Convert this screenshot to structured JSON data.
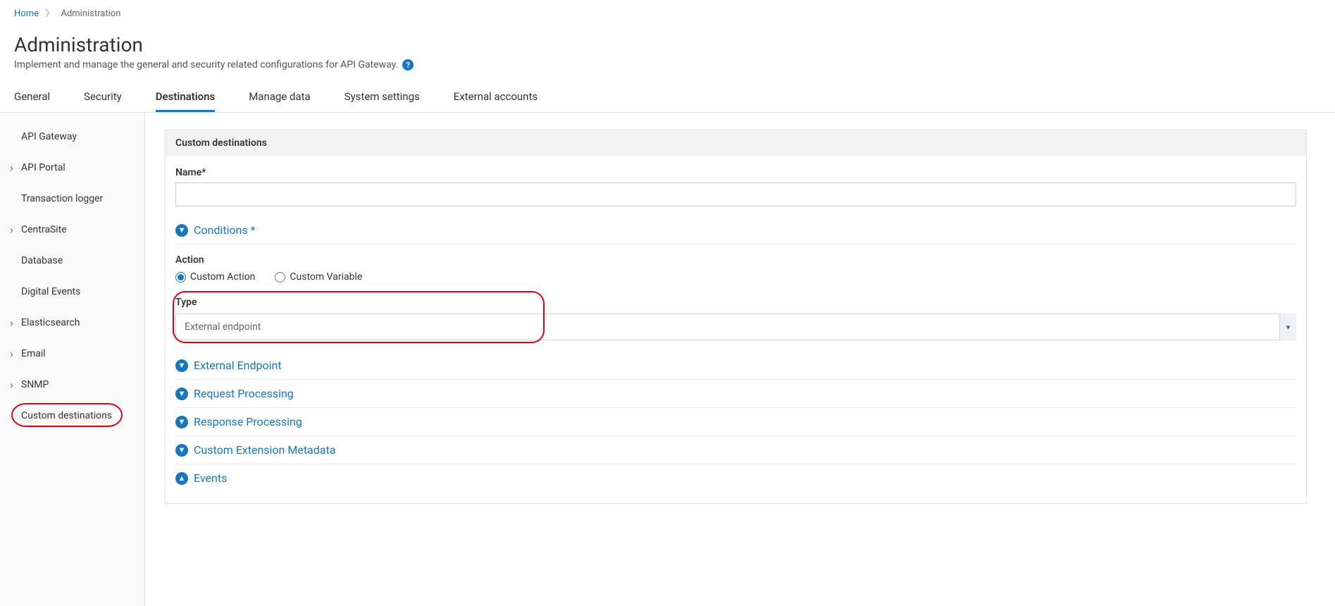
{
  "breadcrumb": {
    "home": "Home",
    "current": "Administration"
  },
  "header": {
    "title": "Administration",
    "subtitle": "Implement and manage the general and security related configurations for API Gateway."
  },
  "tabs": [
    {
      "label": "General",
      "active": false
    },
    {
      "label": "Security",
      "active": false
    },
    {
      "label": "Destinations",
      "active": true
    },
    {
      "label": "Manage data",
      "active": false
    },
    {
      "label": "System settings",
      "active": false
    },
    {
      "label": "External accounts",
      "active": false
    }
  ],
  "sidebar": {
    "items": [
      {
        "label": "API Gateway",
        "chevron": false
      },
      {
        "label": "API Portal",
        "chevron": true
      },
      {
        "label": "Transaction logger",
        "chevron": false
      },
      {
        "label": "CentraSite",
        "chevron": true
      },
      {
        "label": "Database",
        "chevron": false
      },
      {
        "label": "Digital Events",
        "chevron": false
      },
      {
        "label": "Elasticsearch",
        "chevron": true
      },
      {
        "label": "Email",
        "chevron": true
      },
      {
        "label": "SNMP",
        "chevron": true
      },
      {
        "label": "Custom destinations",
        "chevron": false,
        "selected": true
      }
    ]
  },
  "form": {
    "panel_title": "Custom destinations",
    "name_label": "Name*",
    "name_value": "",
    "conditions_label": "Conditions",
    "action_label": "Action",
    "action_options": {
      "custom_action": "Custom Action",
      "custom_variable": "Custom Variable"
    },
    "action_selected": "custom_action",
    "type_label": "Type",
    "type_value": "External endpoint",
    "sections": [
      {
        "label": "External Endpoint",
        "expanded": false,
        "direction": "down"
      },
      {
        "label": "Request Processing",
        "expanded": false,
        "direction": "down"
      },
      {
        "label": "Response Processing",
        "expanded": false,
        "direction": "down"
      },
      {
        "label": "Custom Extension Metadata",
        "expanded": false,
        "direction": "down"
      },
      {
        "label": "Events",
        "expanded": false,
        "direction": "up"
      }
    ]
  }
}
